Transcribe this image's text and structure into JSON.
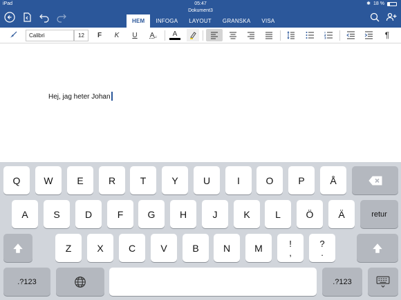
{
  "status_bar": {
    "device": "iPad",
    "time": "05:47",
    "battery": "18 %"
  },
  "document": {
    "title": "Dokument3",
    "text": "Hej, jag heter Johan"
  },
  "tabs": [
    {
      "label": "HEM",
      "active": true
    },
    {
      "label": "INFOGA"
    },
    {
      "label": "LAYOUT"
    },
    {
      "label": "GRANSKA"
    },
    {
      "label": "VISA"
    }
  ],
  "ribbon": {
    "font_name": "Calibri",
    "font_size": "12",
    "bold": "F",
    "italic": "K",
    "underline": "U",
    "text_effects": "A",
    "font_color": "A",
    "accent_color": "#2b579a",
    "font_color_value": "#000000",
    "paragraph_mark": "¶"
  },
  "keyboard": {
    "row1": [
      "Q",
      "W",
      "E",
      "R",
      "T",
      "Y",
      "U",
      "I",
      "O",
      "P",
      "Å"
    ],
    "row2": [
      "A",
      "S",
      "D",
      "F",
      "G",
      "H",
      "J",
      "K",
      "L",
      "Ö",
      "Ä"
    ],
    "row2_return": "retur",
    "row3": [
      "Z",
      "X",
      "C",
      "V",
      "B",
      "N",
      "M"
    ],
    "row3_punct1": [
      "!",
      ","
    ],
    "row3_punct2": [
      "?",
      "."
    ],
    "numbers_left": ".?123",
    "numbers_right": ".?123"
  }
}
